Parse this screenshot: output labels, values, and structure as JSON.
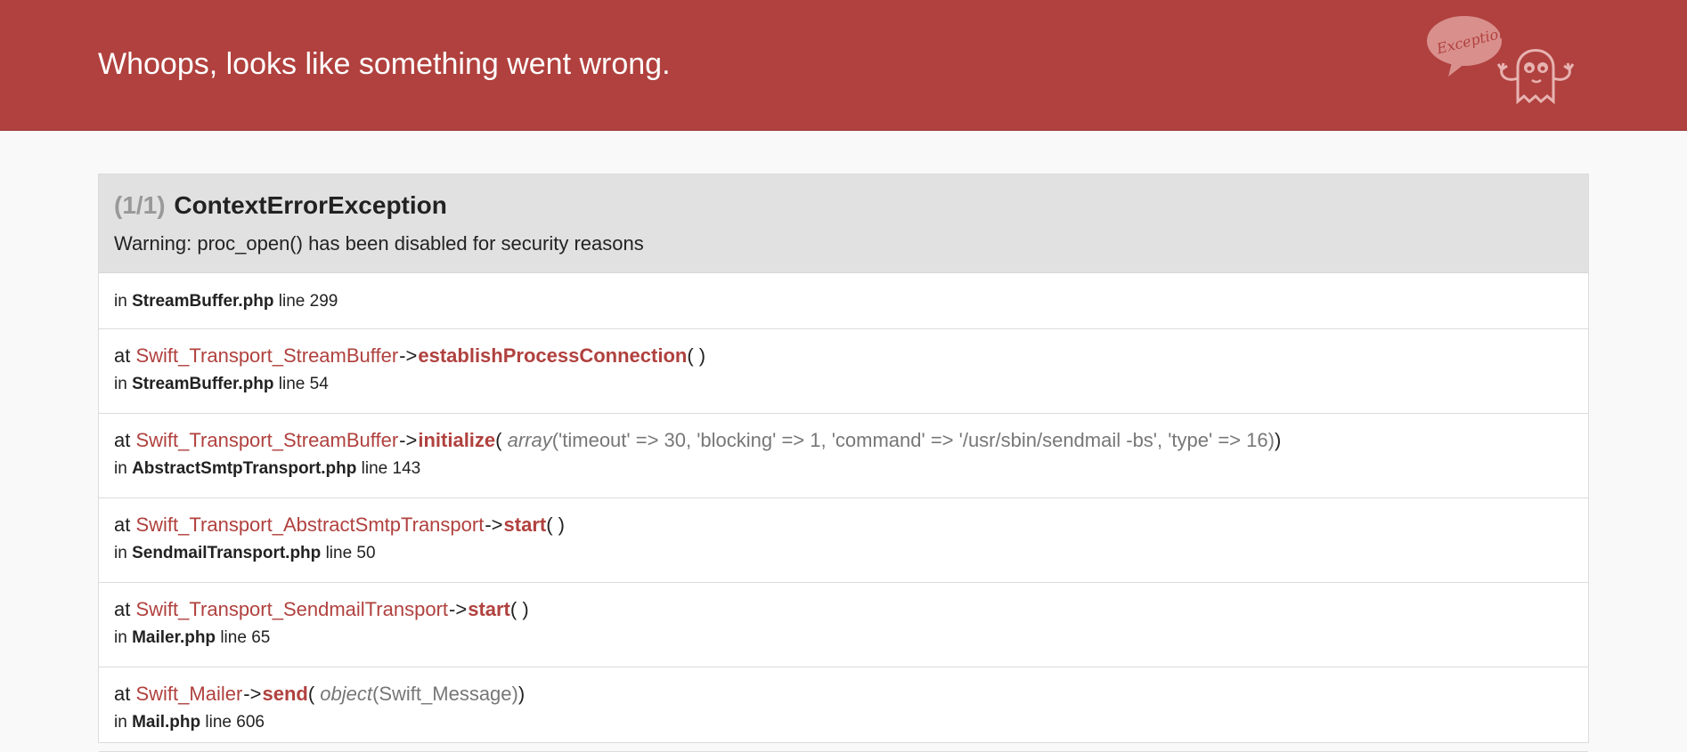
{
  "header": {
    "title": "Whoops, looks like something went wrong.",
    "logo_text": "Exception!",
    "background_color": "#b0413e"
  },
  "exception": {
    "count": "(1/1)",
    "class": "ContextErrorException",
    "message": "Warning: proc_open() has been disabled for security reasons"
  },
  "trace": [
    {
      "in_word": "in",
      "file": "StreamBuffer.php",
      "line_word": "line",
      "line": "299"
    },
    {
      "at_word": "at",
      "class": "Swift_Transport_StreamBuffer",
      "arrow": "->",
      "method": "establishProcessConnection",
      "open": "(",
      "args_type": "",
      "args": "",
      "close": ")",
      "in_word": "in",
      "file": "StreamBuffer.php",
      "line_word": "line",
      "line": "54"
    },
    {
      "at_word": "at",
      "class": "Swift_Transport_StreamBuffer",
      "arrow": "->",
      "method": "initialize",
      "open": "(",
      "args_type": "array",
      "args": "('timeout' => 30, 'blocking' => 1, 'command' => '/usr/sbin/sendmail -bs', 'type' => 16)",
      "close": ")",
      "in_word": "in",
      "file": "AbstractSmtpTransport.php",
      "line_word": "line",
      "line": "143"
    },
    {
      "at_word": "at",
      "class": "Swift_Transport_AbstractSmtpTransport",
      "arrow": "->",
      "method": "start",
      "open": "(",
      "args_type": "",
      "args": "",
      "close": ")",
      "in_word": "in",
      "file": "SendmailTransport.php",
      "line_word": "line",
      "line": "50"
    },
    {
      "at_word": "at",
      "class": "Swift_Transport_SendmailTransport",
      "arrow": "->",
      "method": "start",
      "open": "(",
      "args_type": "",
      "args": "",
      "close": ")",
      "in_word": "in",
      "file": "Mailer.php",
      "line_word": "line",
      "line": "65"
    },
    {
      "at_word": "at",
      "class": "Swift_Mailer",
      "arrow": "->",
      "method": "send",
      "open": "(",
      "args_type": "object",
      "args": "(Swift_Message)",
      "close": ")",
      "in_word": "in",
      "file": "Mail.php",
      "line_word": "line",
      "line": "606"
    }
  ]
}
